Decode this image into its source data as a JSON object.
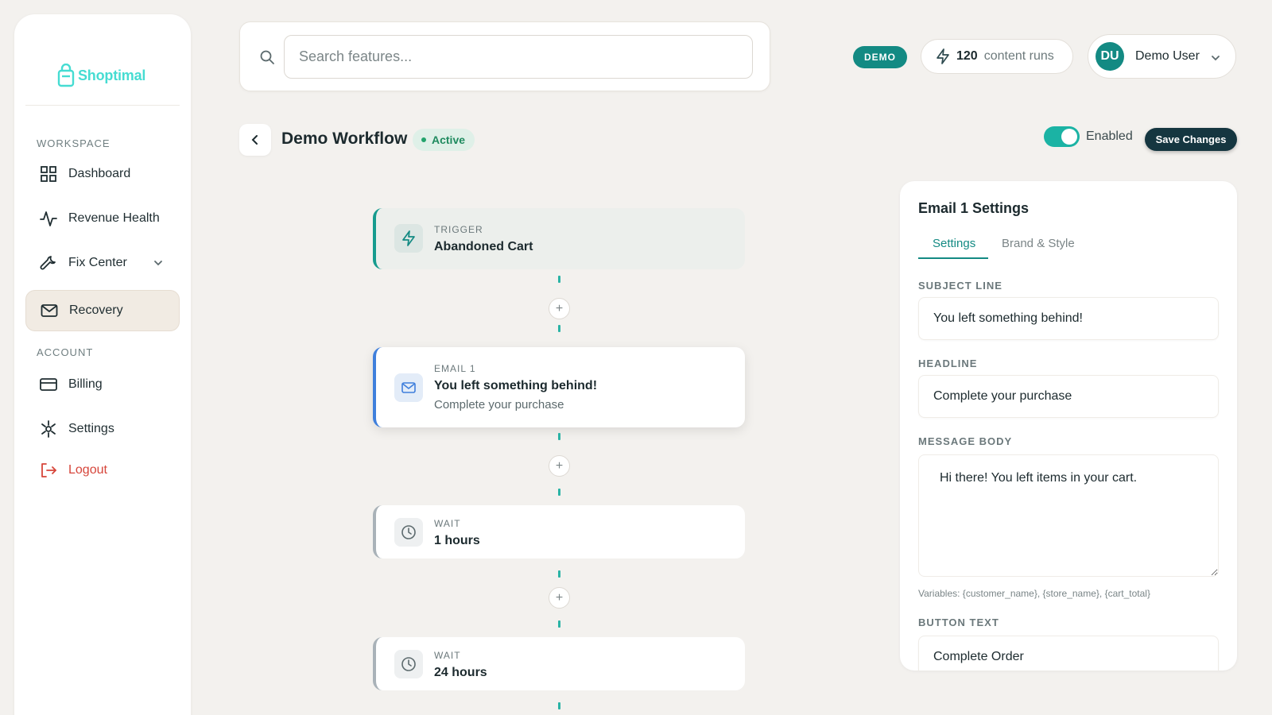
{
  "sidebar": {
    "logo_text": "Shoptimal",
    "sections": {
      "workspace": "WORKSPACE",
      "account": "ACCOUNT"
    },
    "items": {
      "dashboard": "Dashboard",
      "revenue_health": "Revenue Health",
      "fix_center": "Fix Center",
      "recovery": "Recovery",
      "billing": "Billing",
      "settings": "Settings",
      "logout": "Logout"
    },
    "active_item": "Recovery"
  },
  "topbar": {
    "search_placeholder": "Search features...",
    "demo_badge": "DEMO",
    "runs_count": "120",
    "runs_label": "content runs",
    "user_initials": "DU",
    "user_name": "Demo User"
  },
  "workflow": {
    "title": "Demo Workflow",
    "status": "Active",
    "enabled_label": "Enabled",
    "enabled": true,
    "save_label": "Save Changes",
    "nodes": [
      {
        "kicker": "TRIGGER",
        "title": "Abandoned Cart",
        "icon": "bolt-icon"
      },
      {
        "kicker": "EMAIL 1",
        "title": "You left something behind!",
        "subtitle": "Complete your purchase",
        "icon": "mail-icon"
      },
      {
        "kicker": "WAIT",
        "title": "1 hours",
        "icon": "clock-icon"
      },
      {
        "kicker": "WAIT",
        "title": "24 hours",
        "icon": "clock-icon"
      }
    ],
    "add_step_symbol": "+"
  },
  "settings_panel": {
    "title": "Email 1 Settings",
    "tabs": [
      "Settings",
      "Brand & Style"
    ],
    "active_tab": "Settings",
    "subject_label": "SUBJECT LINE",
    "subject_value": "You left something behind!",
    "headline_label": "HEADLINE",
    "headline_value": "Complete your purchase",
    "body_label": "MESSAGE BODY",
    "body_value": "Hi there! You left items in your cart.",
    "variables_hint": "Variables: {customer_name}, {store_name}, {cart_total}",
    "button_label": "BUTTON TEXT",
    "button_value": "Complete Order"
  },
  "colors": {
    "accent": "#138a83",
    "brand": "#46dcd2",
    "background": "#f3f1ee",
    "danger": "#d6453a",
    "email_accent": "#3f7fdc",
    "save_button": "#153640"
  }
}
